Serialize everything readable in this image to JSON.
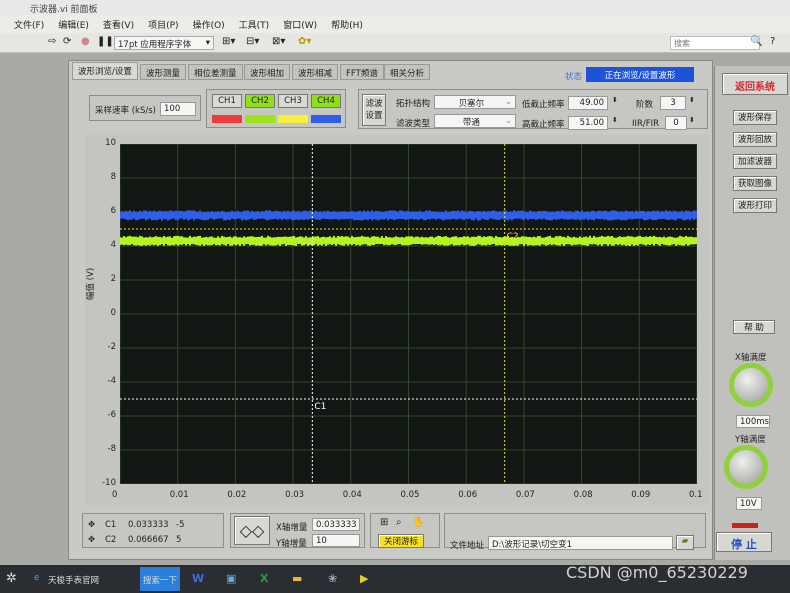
{
  "window": {
    "title": "示波器.vi 前面板"
  },
  "menu": [
    "文件(F)",
    "编辑(E)",
    "查看(V)",
    "项目(P)",
    "操作(O)",
    "工具(T)",
    "窗口(W)",
    "帮助(H)"
  ],
  "toolbar": {
    "font": "17pt 应用程序字体",
    "search_placeholder": "搜索"
  },
  "tabs": [
    "波形浏览/设置",
    "波形测量",
    "相位差测量",
    "波形相加",
    "波形相减",
    "FFT频谱",
    "相关分析"
  ],
  "status": {
    "label": "状态",
    "value": "正在浏览/设置波形"
  },
  "sampling": {
    "label": "采样速率 (kS/s)",
    "value": "100"
  },
  "channels": [
    {
      "label": "CH1",
      "on": false,
      "color": "#ee3b3b"
    },
    {
      "label": "CH2",
      "on": true,
      "color": "#9be21a"
    },
    {
      "label": "CH3",
      "on": false,
      "color": "#f4f03c"
    },
    {
      "label": "CH4",
      "on": true,
      "color": "#2f5fe8"
    }
  ],
  "filter": {
    "button": "滤波设置",
    "topology_label": "拓扑结构",
    "topology": "贝塞尔",
    "type_label": "滤波类型",
    "type": "带通",
    "low_label": "低截止频率",
    "low": "49.00",
    "high_label": "高截止频率",
    "high": "51.00",
    "order_label": "阶数",
    "order": "3",
    "iir_label": "IIR/FIR",
    "iir": "0"
  },
  "right_panel": {
    "return": "返回系统",
    "buttons": [
      "波形保存",
      "波形回放",
      "加滤波器",
      "获取图像",
      "波形打印"
    ],
    "help": "帮 助",
    "x_scale_label": "X轴满度",
    "x_scale": "100ms",
    "y_scale_label": "Y轴满度",
    "y_scale": "10V",
    "stop": "停 止"
  },
  "chart_data": {
    "type": "line",
    "xlabel": "",
    "ylabel": "幅值 (V)",
    "xlim": [
      0,
      0.1
    ],
    "ylim": [
      -10,
      10
    ],
    "grid": true,
    "xticks": [
      "0",
      "0.01",
      "0.02",
      "0.03",
      "0.04",
      "0.05",
      "0.06",
      "0.07",
      "0.08",
      "0.09",
      "0.1"
    ],
    "yticks": [
      "10",
      "8",
      "6",
      "4",
      "2",
      "0",
      "-2",
      "-4",
      "-6",
      "-8",
      "-10"
    ],
    "series": [
      {
        "channel": "CH4",
        "color": "#2f5fe8",
        "mean": 5.8,
        "min": 5.5,
        "max": 6.1
      },
      {
        "channel": "CH2",
        "color": "#b4f51e",
        "mean": 4.3,
        "min": 4.0,
        "max": 4.6
      }
    ],
    "cursors": [
      {
        "name": "C1",
        "x": 0.033333,
        "y": -5,
        "color": "#ffffff"
      },
      {
        "name": "C2",
        "x": 0.066667,
        "y": 5,
        "color": "#e8e23a"
      }
    ]
  },
  "cursor_table": [
    {
      "name": "C1",
      "x": "0.033333",
      "y": "-5"
    },
    {
      "name": "C2",
      "x": "0.066667",
      "y": "5"
    }
  ],
  "increment": {
    "x_label": "X轴增量",
    "x": "0.033333",
    "y_label": "Y轴增量",
    "y": "10"
  },
  "cursor_toggle": "关闭游标",
  "file": {
    "label": "文件地址",
    "path": "D:\\波形记录\\切空变1"
  },
  "taskbar": {
    "browser": "天梭手表官网",
    "search_btn": "搜索一下"
  },
  "watermark": "CSDN @m0_65230229"
}
